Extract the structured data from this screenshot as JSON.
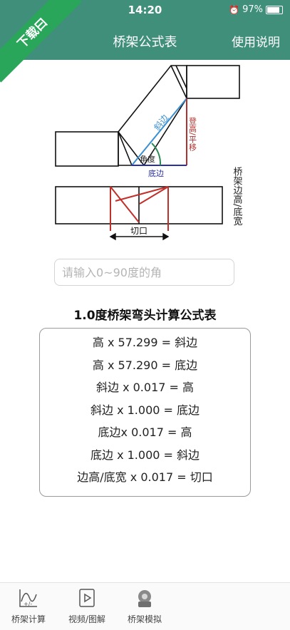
{
  "status_bar": {
    "time": "14:20",
    "battery": "97%",
    "battery_level": 0.97
  },
  "badge": {
    "text": "下载曰"
  },
  "header": {
    "title": "桥架公式表",
    "help_label": "使用说明"
  },
  "diagram": {
    "hypotenuse_label": "斜边",
    "rise_label": "登高/平移",
    "angle_label": "角度",
    "base_label": "底边",
    "side_label": "桥架边高/底宽",
    "cut_label": "切口"
  },
  "input": {
    "placeholder": "请输入0~90度的角",
    "value": ""
  },
  "table": {
    "title": "1.0度桥架弯头计算公式表",
    "rows": [
      "高 x 57.299 = 斜边",
      "高 x 57.290 = 底边",
      "斜边 x 0.017 = 高",
      "斜边 x 1.000 = 底边",
      "底边x 0.017 = 高",
      "底边 x 1.000 = 斜边",
      "边高/底宽 x 0.017 = 切口"
    ]
  },
  "tabs": [
    {
      "label": "桥架计算",
      "icon": "chart-calculator-icon"
    },
    {
      "label": "视频/图解",
      "icon": "video-play-icon"
    },
    {
      "label": "桥架模拟",
      "icon": "simulation-icon"
    }
  ],
  "colors": {
    "primary": "#3f8f7a",
    "badge": "#2aa65a",
    "hypotenuse": "#3a8fd0",
    "rise": "#b0322e",
    "base": "#2b2fa0",
    "angle_arc": "#2e8b57"
  }
}
